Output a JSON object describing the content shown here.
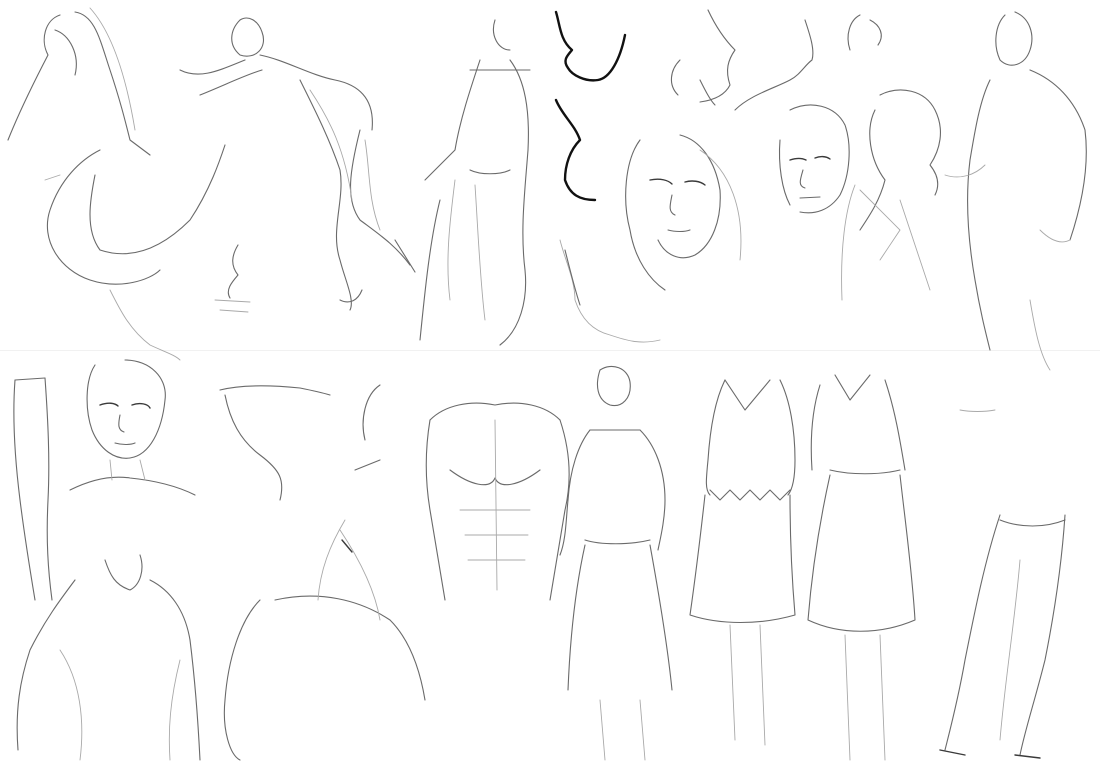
{
  "image": {
    "kind": "pencil figure-drawing study sheet",
    "colors": {
      "paper": "#ffffff",
      "pencil": "#6a6a6a",
      "light_pencil": "#a9a9a9",
      "ink": "#111111"
    },
    "sketches": [
      "acrobat-upside-down-figure",
      "leaping-figure",
      "small-nose-profile-sketch",
      "standing-torso-figure",
      "ink-profile-faces",
      "profile-heads-cluster",
      "sad-woman-face",
      "bald-man-face",
      "curly-hair-woman-profile",
      "tall-standing-figure-right",
      "woman-in-skirt-figure",
      "dress-figure-left",
      "dress-figure-right",
      "young-man-portrait",
      "t-shirt-torso",
      "raised-arm-figure",
      "muscular-male-torso",
      "shoulder-back-study",
      "arm-study-left",
      "legs-figure-bottom-right"
    ]
  }
}
